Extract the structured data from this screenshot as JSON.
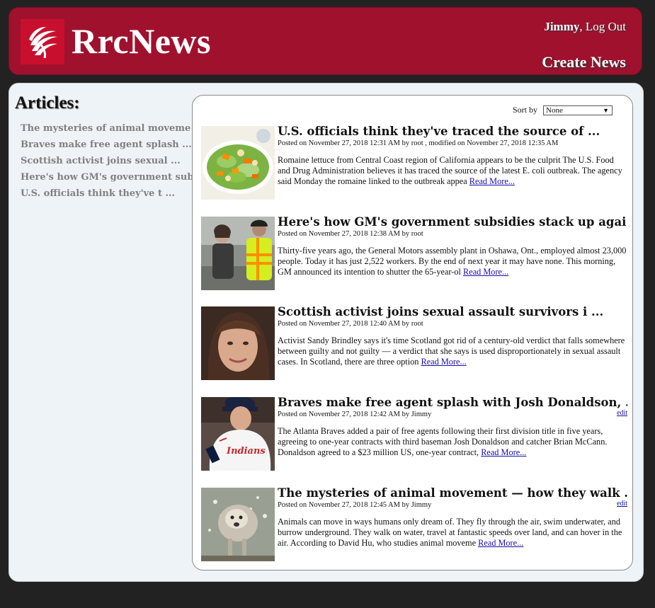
{
  "header": {
    "brand": "RrcNews",
    "username": "Jimmy",
    "separator": ",",
    "logout_label": " Log Out",
    "create_news_label": "Create News",
    "colors": {
      "header_bg": "#a0112e",
      "logo_bg": "#c8102e"
    },
    "logo_icon": "wing-logo-icon"
  },
  "sidebar": {
    "title": "Articles:",
    "items": [
      {
        "label": "The mysteries of animal moveme ..."
      },
      {
        "label": "Braves make free agent splash ..."
      },
      {
        "label": "Scottish activist joins sexual ..."
      },
      {
        "label": "Here's how GM's government sub"
      },
      {
        "label": "U.S. officials think they've t ..."
      }
    ]
  },
  "sort": {
    "label": "Sort by",
    "selected": "None"
  },
  "articles": [
    {
      "title": "U.S. officials think they've traced the source of ...",
      "meta": "Posted on November 27, 2018 12:31 AM by root , modified on November 27, 2018 12:35 AM",
      "excerpt": "Romaine lettuce from Central Coast region of California appears to be the culprit The U.S. Food and Drug Administration believes it has traced the source of the latest E. coli outbreak. The agency said Monday the romaine linked to the outbreak appea ",
      "read_more": "Read More...",
      "image": "salad-photo"
    },
    {
      "title": "Here's how GM's government subsidies stack up agai ...",
      "meta": "Posted on November 27, 2018 12:38 AM by root",
      "excerpt": "Thirty-five years ago, the General Motors assembly plant in Oshawa, Ont., employed almost 23,000 people. Today it has just 2,522 workers. By the end of next year it may have none. This morning, GM announced its intention to shutter the 65-year-ol ",
      "read_more": "Read More...",
      "image": "workers-photo"
    },
    {
      "title": "Scottish activist joins sexual assault survivors i ...",
      "meta": "Posted on November 27, 2018 12:40 AM by root",
      "excerpt": "Activist Sandy Brindley says it's time Scotland got rid of a century-old verdict that falls somewhere between guilty and not guilty — a verdict that she says is used disproportionately in sexual assault cases. In Scotland, there are three option ",
      "read_more": "Read More...",
      "image": "portrait-photo"
    },
    {
      "title": "Braves make free agent splash with Josh Donaldson, ...",
      "meta": "Posted on November 27, 2018 12:42 AM by Jimmy",
      "edit": "edit",
      "excerpt": "The Atlanta Braves added a pair of free agents following their first division title in five years, agreeing to one-year contracts with third baseman Josh Donaldson and catcher Brian McCann. Donaldson agreed to a $23 million US, one-year contract, ",
      "read_more": "Read More...",
      "image": "baseball-photo"
    },
    {
      "title": "The mysteries of animal movement — how they walk ...",
      "meta": "Posted on November 27, 2018 12:45 AM by Jimmy",
      "edit": "edit",
      "excerpt": "Animals can move in ways humans only dream of. They fly through the air, swim underwater, and burrow underground. They walk on water, travel at fantastic speeds over land, and can hover in the air. According to David Hu, who studies animal moveme ",
      "read_more": "Read More...",
      "image": "dog-photo"
    }
  ]
}
